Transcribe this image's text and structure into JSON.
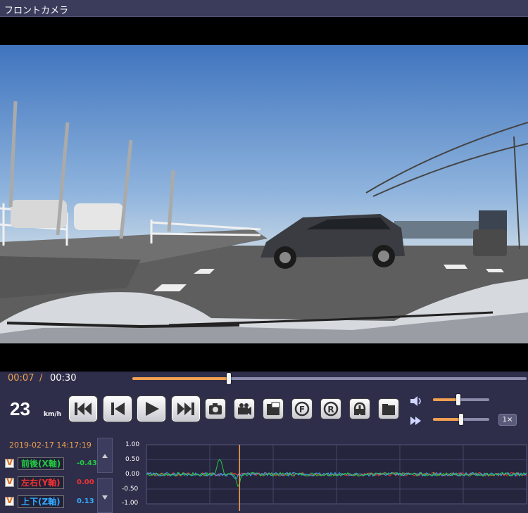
{
  "window": {
    "title": "フロントカメラ"
  },
  "playback": {
    "current_time": "00:07",
    "separator": "/",
    "total_time": "00:30",
    "progress": 0.245
  },
  "speed": {
    "value": "23",
    "unit": "km/h"
  },
  "buttons": [
    {
      "name": "skip-to-start-button",
      "icon": "skip-back-icon"
    },
    {
      "name": "previous-frame-button",
      "icon": "step-back-icon"
    },
    {
      "name": "play-button",
      "icon": "play-icon"
    },
    {
      "name": "skip-to-end-button",
      "icon": "skip-forward-icon"
    },
    {
      "name": "snapshot-button",
      "icon": "camera-icon"
    },
    {
      "name": "record-clip-button",
      "icon": "video-camera-icon"
    },
    {
      "name": "open-file-button",
      "icon": "open-folder-icon"
    },
    {
      "name": "front-camera-button",
      "icon": "front-camera-f-icon",
      "label": "F"
    },
    {
      "name": "rear-camera-button",
      "icon": "rear-camera-r-icon",
      "label": "R"
    },
    {
      "name": "export-button",
      "icon": "export-icon"
    },
    {
      "name": "folder-button",
      "icon": "folder-icon"
    }
  ],
  "volume": {
    "level": 0.45
  },
  "playback_speed": {
    "level": 0.5,
    "rate_label": "1×"
  },
  "sensor": {
    "datetime": "2019-02-17 14:17:19",
    "axes": [
      {
        "label": "前後(X軸)",
        "value": "-0.43",
        "color": "#22cc44",
        "checked": true,
        "check_mark": "V"
      },
      {
        "label": "左右(Y軸)",
        "value": "0.00",
        "color": "#ee3333",
        "checked": true,
        "check_mark": "V"
      },
      {
        "label": "上下(Z軸)",
        "value": "0.13",
        "color": "#33aaff",
        "checked": true,
        "check_mark": "V"
      }
    ]
  },
  "chart_data": {
    "type": "line",
    "y_ticks": [
      "1.00",
      "0.50",
      "0.00",
      "-0.50",
      "-1.00"
    ],
    "ylim": [
      -1,
      1
    ],
    "cursor_fraction": 0.245,
    "series_colors": {
      "x": "#22cc44",
      "y": "#ee3333",
      "z": "#33aaff"
    }
  },
  "colors": {
    "accent": "#f0a050",
    "background": "#2e2e4a"
  }
}
